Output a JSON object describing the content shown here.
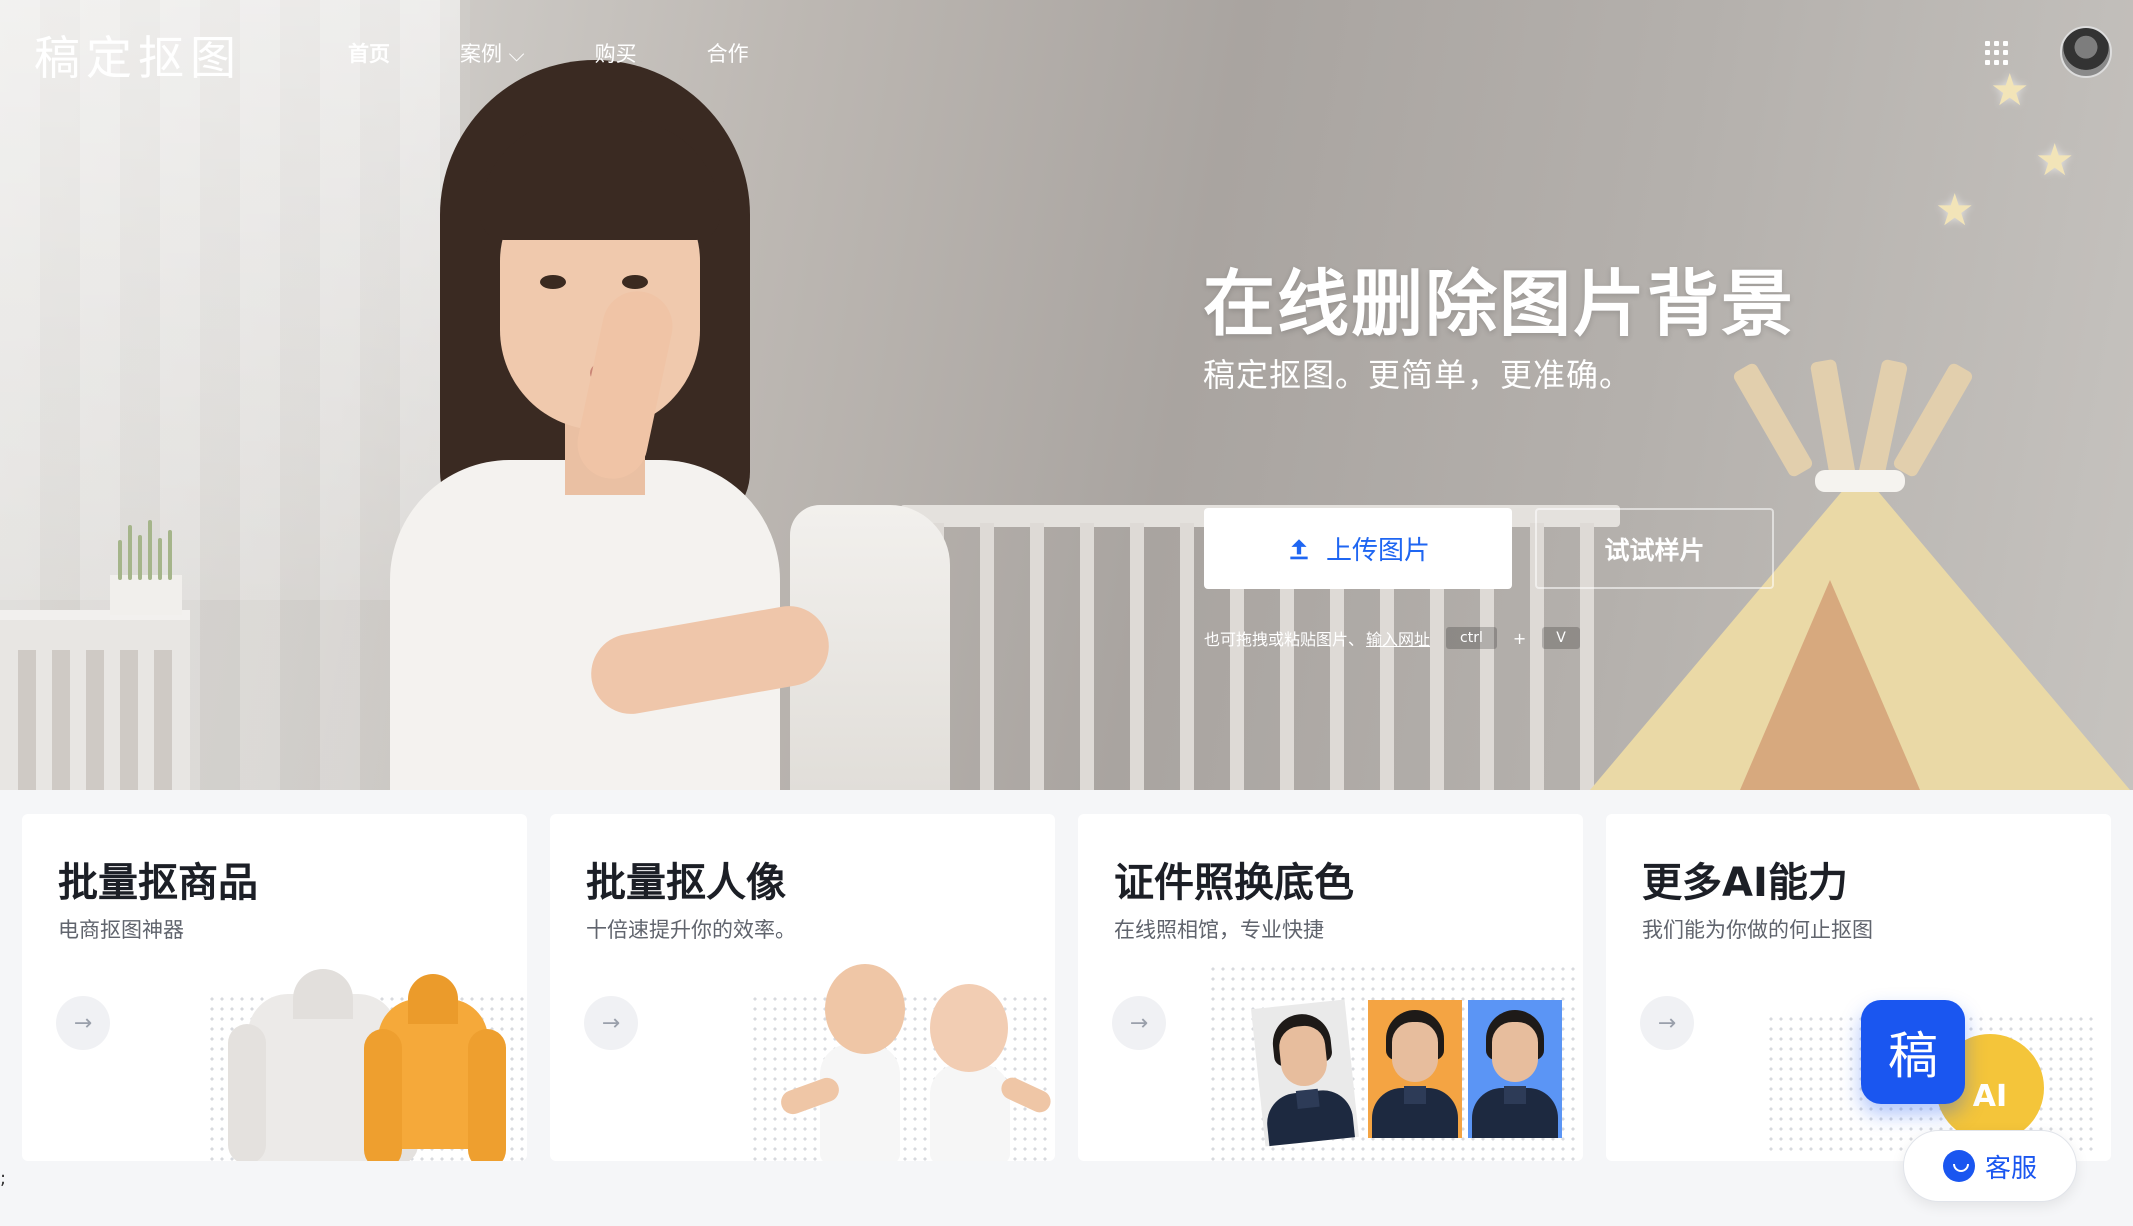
{
  "header": {
    "logo": "稿定抠图",
    "nav": [
      {
        "label": "首页",
        "active": true
      },
      {
        "label": "案例 ⌵",
        "active": false
      },
      {
        "label": "购买",
        "active": false
      },
      {
        "label": "合作",
        "active": false
      }
    ],
    "apps_icon": "grid-icon",
    "avatar": "user-avatar"
  },
  "hero": {
    "title": "在线删除图片背景",
    "subtitle": "稿定抠图。更简单，更准确。",
    "upload_button": "上传图片",
    "sample_button": "试试样片",
    "hint_text": "也可拖拽或粘贴图片、",
    "hint_link": "输入网址",
    "key_ctrl": "ctrl",
    "key_plus": "+",
    "key_v": "V"
  },
  "cards": [
    {
      "title": "批量抠商品",
      "desc": "电商抠图神器",
      "arrow": "→"
    },
    {
      "title": "批量抠人像",
      "desc": "十倍速提升你的效率。",
      "arrow": "→"
    },
    {
      "title": "证件照换底色",
      "desc": "在线照相馆，专业快捷",
      "arrow": "→"
    },
    {
      "title": "更多AI能力",
      "desc": "我们能为你做的何止抠图",
      "arrow": "→"
    }
  ],
  "badges": {
    "gao": "稿",
    "ai": "AI"
  },
  "service": {
    "label": "客服"
  },
  "stray_char": ";",
  "colors": {
    "accent": "#1a56f0",
    "upload_text": "#1f66f2",
    "id_bg_orange": "#f4a443",
    "id_bg_blue": "#5b95f5"
  }
}
